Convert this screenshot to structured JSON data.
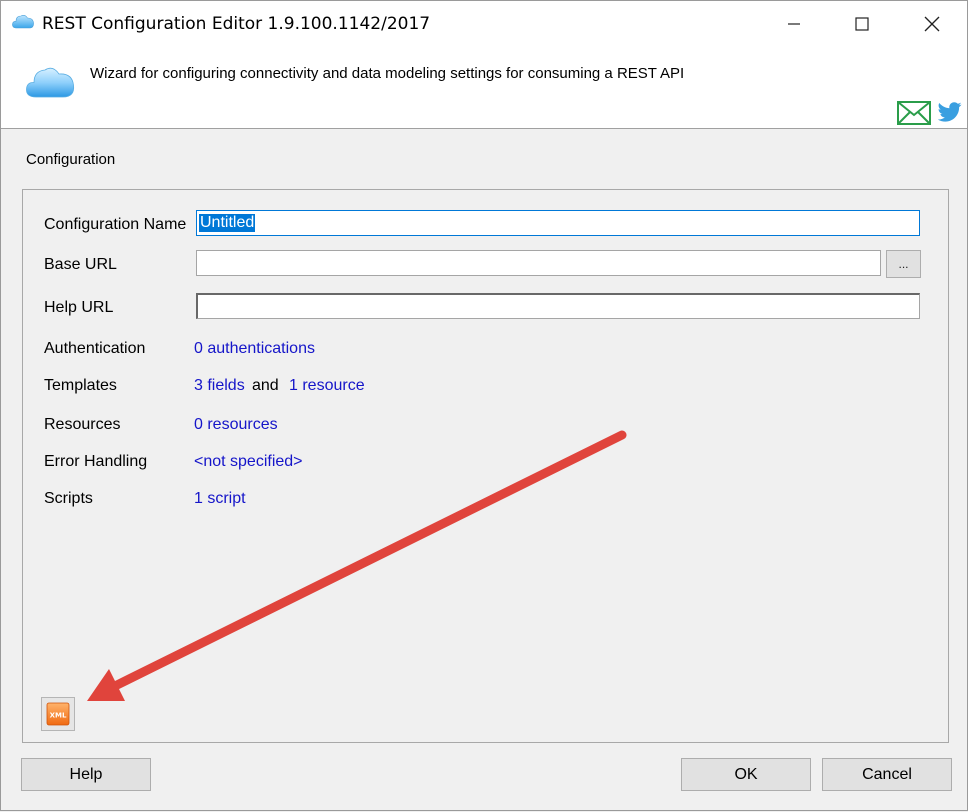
{
  "window": {
    "title": "REST Configuration Editor 1.9.100.1142/2017",
    "icon": "cloud-icon",
    "controls": [
      "minimize-icon",
      "maximize-icon",
      "close-icon"
    ]
  },
  "header": {
    "description": "Wizard for configuring connectivity and data modeling settings for consuming a REST API",
    "icons": [
      "cloud-icon",
      "mail-icon",
      "twitter-icon"
    ]
  },
  "section": {
    "title": "Configuration"
  },
  "form": {
    "config_name_label": "Configuration Name",
    "config_name_value": "Untitled",
    "base_url_label": "Base URL",
    "base_url_value": "",
    "browse_label": "...",
    "help_url_label": "Help URL",
    "help_url_value": "",
    "authentication_label": "Authentication",
    "authentication_link": "0 authentications",
    "templates_label": "Templates",
    "templates_fields_link": "3 fields",
    "templates_and": "and",
    "templates_resource_link": "1 resource",
    "resources_label": "Resources",
    "resources_link": "0 resources",
    "error_handling_label": "Error Handling",
    "error_handling_link": "<not specified>",
    "scripts_label": "Scripts",
    "scripts_link": "1 script"
  },
  "xml_button": {
    "icon": "xml-icon",
    "icon_text": "XML"
  },
  "annotation": {
    "color": "#e0443c"
  },
  "buttons": {
    "help": "Help",
    "ok": "OK",
    "cancel": "Cancel"
  },
  "colors": {
    "link": "#1515c9",
    "selection": "#0078d7"
  }
}
